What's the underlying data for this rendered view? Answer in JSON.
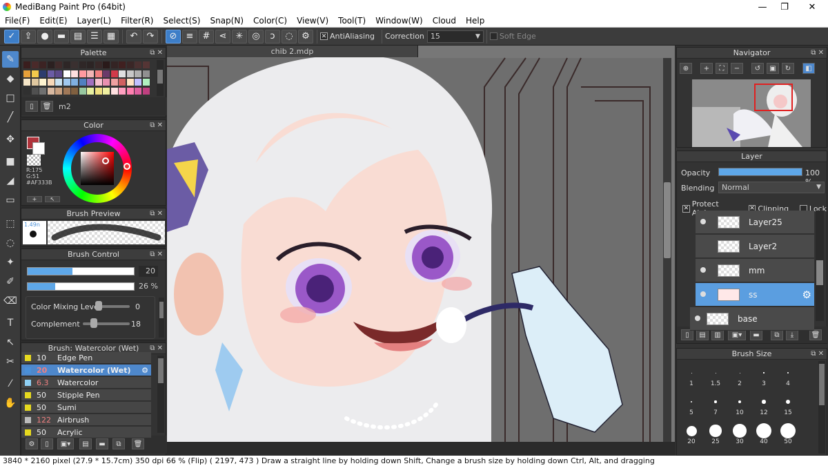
{
  "window": {
    "title": "MediBang Paint Pro (64bit)",
    "minimize": "—",
    "maximize": "❐",
    "close": "✕"
  },
  "menu": [
    "File(F)",
    "Edit(E)",
    "Layer(L)",
    "Filter(R)",
    "Select(S)",
    "Snap(N)",
    "Color(C)",
    "View(V)",
    "Tool(T)",
    "Window(W)",
    "Cloud",
    "Help"
  ],
  "toolbar": {
    "antialiasing": "AntiAliasing",
    "correction_label": "Correction",
    "correction_value": "15",
    "soft_edge": "Soft Edge"
  },
  "document_tab": "chib 2.mdp",
  "palette": {
    "title": "Palette",
    "name": "m2",
    "colors": [
      "#3a1e1e",
      "#4a2a2a",
      "#3c2323",
      "#2b2020",
      "#402a2a",
      "#2e2626",
      "#3a3030",
      "#2f2727",
      "#2c2424",
      "#382828",
      "#2a1a1a",
      "#342424",
      "#402020",
      "#3a2626",
      "#4a3030",
      "#553535",
      "#e6a03a",
      "#f2c94c",
      "#2e3d6e",
      "#6b5ca5",
      "#5e4b8b",
      "#ffffff",
      "#ffdede",
      "#ff9aa0",
      "#f2b5b5",
      "#f08080",
      "#6a3a6a",
      "#d23a4a",
      "#e0e0e0",
      "#c8c8c8",
      "#b0b0b0",
      "#909090",
      "#f5e6c8",
      "#e0c8a0",
      "#fff4d0",
      "#f8d8b8",
      "#c8e0f0",
      "#a0c8f0",
      "#80b0e0",
      "#5080c0",
      "#a070c0",
      "#f5c0d0",
      "#e890b0",
      "#f0a0a0",
      "#d06060",
      "#ffe4c4",
      "#c0c0ff",
      "#b0f0c0",
      "#303030",
      "#505050",
      "#707070",
      "#d8b8a0",
      "#c8a080",
      "#a07858",
      "#806040",
      "#98c8a0",
      "#e8f0a0",
      "#f0e080",
      "#f0f0a0",
      "#ffe0e0",
      "#ffa0c0",
      "#ff80b0",
      "#e060a0",
      "#c04080"
    ]
  },
  "color": {
    "title": "Color",
    "main": "#AF333B",
    "r": "R:175",
    "g": "G:51",
    "b": "B:59",
    "hex": "#AF333B",
    "btn1": "+",
    "btn2": "↖"
  },
  "brush_preview": {
    "title": "Brush Preview",
    "size": "1.49n"
  },
  "brush_control": {
    "title": "Brush Control",
    "size_value": 20,
    "size_pct": 0.42,
    "opacity_value": "26 %",
    "opacity_pct": 0.26,
    "mixing_label": "Color Mixing Level",
    "mixing_value": "0",
    "mixing_pct": 0.0,
    "complement_label": "Complement",
    "complement_value": "18",
    "complement_pct": 0.18
  },
  "brush_list": {
    "title": "Brush: Watercolor (Wet)",
    "items": [
      {
        "size": "10",
        "name": "Edge Pen",
        "color": "#e6d91f",
        "size_color": "#eee"
      },
      {
        "size": "20",
        "name": "Watercolor (Wet)",
        "color": "#4a90d9",
        "size_color": "#f08080",
        "selected": true
      },
      {
        "size": "6.3",
        "name": "Watercolor",
        "color": "#8fd0f5",
        "size_color": "#f08080"
      },
      {
        "size": "50",
        "name": "Stipple Pen",
        "color": "#e6d91f",
        "size_color": "#eee"
      },
      {
        "size": "50",
        "name": "Sumi",
        "color": "#e6d91f",
        "size_color": "#eee"
      },
      {
        "size": "122",
        "name": "Airbrush",
        "color": "#bbbbbb",
        "size_color": "#f08080"
      },
      {
        "size": "50",
        "name": "Acrylic",
        "color": "#e6d91f",
        "size_color": "#eee"
      }
    ]
  },
  "navigator": {
    "title": "Navigator"
  },
  "layer": {
    "title": "Layer",
    "opacity_label": "Opacity",
    "opacity_value": "100 %",
    "opacity_pct": 1.0,
    "blending_label": "Blending",
    "blending_value": "Normal",
    "protect_alpha": "Protect Alpha",
    "clipping": "Clipping",
    "lock": "Lock",
    "items": [
      {
        "name": "Layer25",
        "visible": true
      },
      {
        "name": "Layer2",
        "visible": false
      },
      {
        "name": "mm",
        "visible": true
      },
      {
        "name": "ss",
        "visible": true,
        "selected": true
      },
      {
        "name": "base",
        "visible": true
      }
    ]
  },
  "brush_size": {
    "title": "Brush Size",
    "sizes": [
      "1",
      "1.5",
      "2",
      "3",
      "4",
      "5",
      "7",
      "10",
      "12",
      "15",
      "20",
      "25",
      "30",
      "40",
      "50"
    ]
  },
  "status": "3840 * 2160 pixel   (27.9 * 15.7cm)   350 dpi   66 % (Flip)   ( 2197, 473 )   Draw a straight line by holding down Shift, Change a brush size by holding down Ctrl, Alt, and dragging"
}
